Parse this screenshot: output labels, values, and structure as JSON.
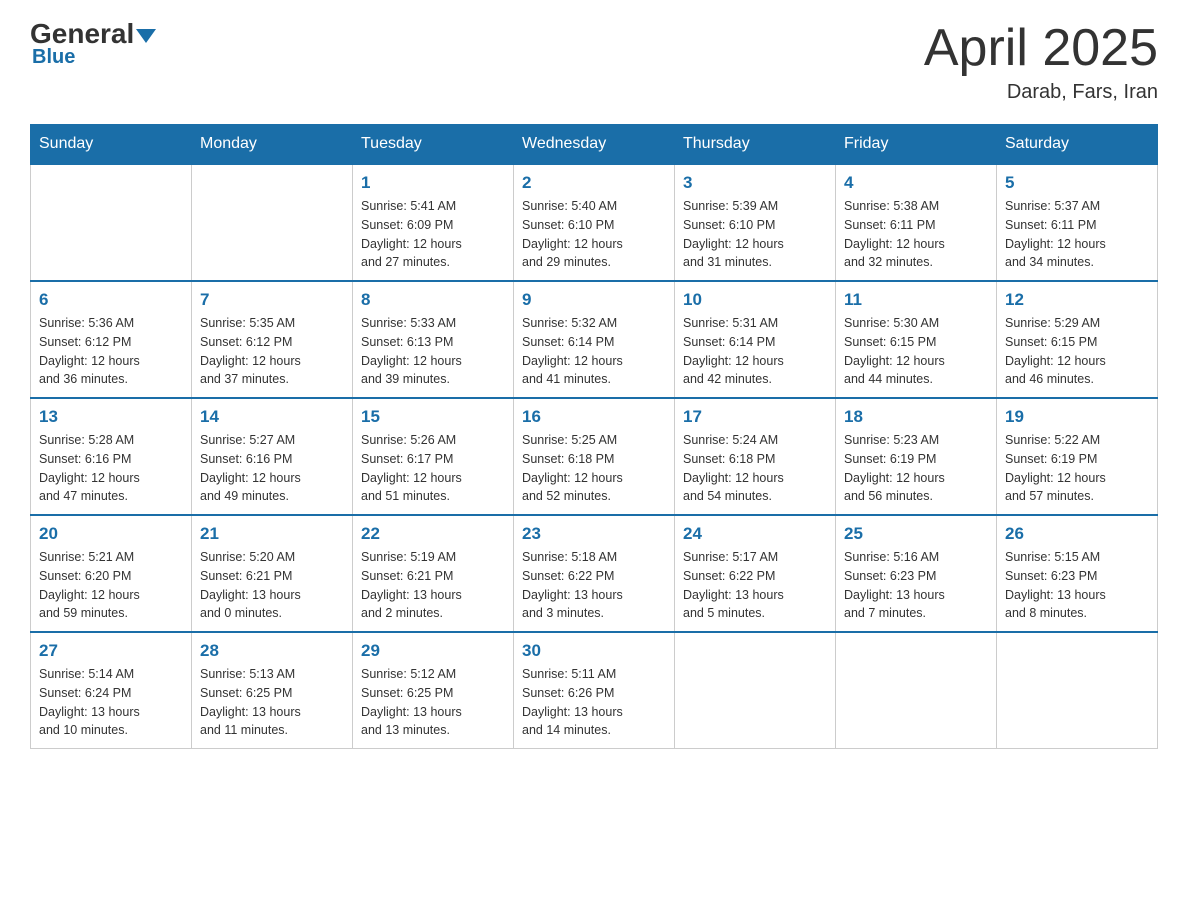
{
  "header": {
    "logo_general": "General",
    "logo_blue": "Blue",
    "month": "April 2025",
    "location": "Darab, Fars, Iran"
  },
  "days_of_week": [
    "Sunday",
    "Monday",
    "Tuesday",
    "Wednesday",
    "Thursday",
    "Friday",
    "Saturday"
  ],
  "weeks": [
    [
      {
        "num": "",
        "info": ""
      },
      {
        "num": "",
        "info": ""
      },
      {
        "num": "1",
        "info": "Sunrise: 5:41 AM\nSunset: 6:09 PM\nDaylight: 12 hours\nand 27 minutes."
      },
      {
        "num": "2",
        "info": "Sunrise: 5:40 AM\nSunset: 6:10 PM\nDaylight: 12 hours\nand 29 minutes."
      },
      {
        "num": "3",
        "info": "Sunrise: 5:39 AM\nSunset: 6:10 PM\nDaylight: 12 hours\nand 31 minutes."
      },
      {
        "num": "4",
        "info": "Sunrise: 5:38 AM\nSunset: 6:11 PM\nDaylight: 12 hours\nand 32 minutes."
      },
      {
        "num": "5",
        "info": "Sunrise: 5:37 AM\nSunset: 6:11 PM\nDaylight: 12 hours\nand 34 minutes."
      }
    ],
    [
      {
        "num": "6",
        "info": "Sunrise: 5:36 AM\nSunset: 6:12 PM\nDaylight: 12 hours\nand 36 minutes."
      },
      {
        "num": "7",
        "info": "Sunrise: 5:35 AM\nSunset: 6:12 PM\nDaylight: 12 hours\nand 37 minutes."
      },
      {
        "num": "8",
        "info": "Sunrise: 5:33 AM\nSunset: 6:13 PM\nDaylight: 12 hours\nand 39 minutes."
      },
      {
        "num": "9",
        "info": "Sunrise: 5:32 AM\nSunset: 6:14 PM\nDaylight: 12 hours\nand 41 minutes."
      },
      {
        "num": "10",
        "info": "Sunrise: 5:31 AM\nSunset: 6:14 PM\nDaylight: 12 hours\nand 42 minutes."
      },
      {
        "num": "11",
        "info": "Sunrise: 5:30 AM\nSunset: 6:15 PM\nDaylight: 12 hours\nand 44 minutes."
      },
      {
        "num": "12",
        "info": "Sunrise: 5:29 AM\nSunset: 6:15 PM\nDaylight: 12 hours\nand 46 minutes."
      }
    ],
    [
      {
        "num": "13",
        "info": "Sunrise: 5:28 AM\nSunset: 6:16 PM\nDaylight: 12 hours\nand 47 minutes."
      },
      {
        "num": "14",
        "info": "Sunrise: 5:27 AM\nSunset: 6:16 PM\nDaylight: 12 hours\nand 49 minutes."
      },
      {
        "num": "15",
        "info": "Sunrise: 5:26 AM\nSunset: 6:17 PM\nDaylight: 12 hours\nand 51 minutes."
      },
      {
        "num": "16",
        "info": "Sunrise: 5:25 AM\nSunset: 6:18 PM\nDaylight: 12 hours\nand 52 minutes."
      },
      {
        "num": "17",
        "info": "Sunrise: 5:24 AM\nSunset: 6:18 PM\nDaylight: 12 hours\nand 54 minutes."
      },
      {
        "num": "18",
        "info": "Sunrise: 5:23 AM\nSunset: 6:19 PM\nDaylight: 12 hours\nand 56 minutes."
      },
      {
        "num": "19",
        "info": "Sunrise: 5:22 AM\nSunset: 6:19 PM\nDaylight: 12 hours\nand 57 minutes."
      }
    ],
    [
      {
        "num": "20",
        "info": "Sunrise: 5:21 AM\nSunset: 6:20 PM\nDaylight: 12 hours\nand 59 minutes."
      },
      {
        "num": "21",
        "info": "Sunrise: 5:20 AM\nSunset: 6:21 PM\nDaylight: 13 hours\nand 0 minutes."
      },
      {
        "num": "22",
        "info": "Sunrise: 5:19 AM\nSunset: 6:21 PM\nDaylight: 13 hours\nand 2 minutes."
      },
      {
        "num": "23",
        "info": "Sunrise: 5:18 AM\nSunset: 6:22 PM\nDaylight: 13 hours\nand 3 minutes."
      },
      {
        "num": "24",
        "info": "Sunrise: 5:17 AM\nSunset: 6:22 PM\nDaylight: 13 hours\nand 5 minutes."
      },
      {
        "num": "25",
        "info": "Sunrise: 5:16 AM\nSunset: 6:23 PM\nDaylight: 13 hours\nand 7 minutes."
      },
      {
        "num": "26",
        "info": "Sunrise: 5:15 AM\nSunset: 6:23 PM\nDaylight: 13 hours\nand 8 minutes."
      }
    ],
    [
      {
        "num": "27",
        "info": "Sunrise: 5:14 AM\nSunset: 6:24 PM\nDaylight: 13 hours\nand 10 minutes."
      },
      {
        "num": "28",
        "info": "Sunrise: 5:13 AM\nSunset: 6:25 PM\nDaylight: 13 hours\nand 11 minutes."
      },
      {
        "num": "29",
        "info": "Sunrise: 5:12 AM\nSunset: 6:25 PM\nDaylight: 13 hours\nand 13 minutes."
      },
      {
        "num": "30",
        "info": "Sunrise: 5:11 AM\nSunset: 6:26 PM\nDaylight: 13 hours\nand 14 minutes."
      },
      {
        "num": "",
        "info": ""
      },
      {
        "num": "",
        "info": ""
      },
      {
        "num": "",
        "info": ""
      }
    ]
  ]
}
